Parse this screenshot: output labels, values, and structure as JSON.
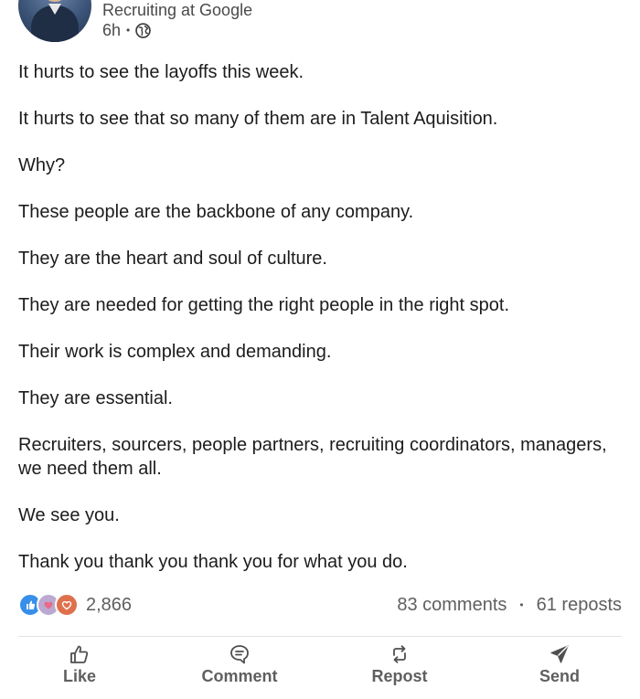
{
  "post": {
    "author_subtitle": "Recruiting at Google",
    "time_ago": "6h",
    "time_separator": "•",
    "visibility_icon": "globe-icon",
    "paragraphs": [
      "It hurts to see the layoffs this week.",
      "It hurts to see that so many of them are in Talent Aquisition.",
      "Why?",
      "These people are the backbone of any company.",
      "They are the heart and soul of culture.",
      "They are needed for getting the right people in the right spot.",
      "Their work is complex and demanding.",
      "They are essential.",
      "Recruiters, sourcers, people partners, recruiting coordinators, managers, we need them all.",
      "We see you.",
      "Thank you thank you thank you for what you do."
    ]
  },
  "social": {
    "reaction_icons": [
      "like-reaction-icon",
      "support-reaction-icon",
      "love-reaction-icon"
    ],
    "reactions_count": "2,866",
    "comments": "83 comments",
    "separator": "•",
    "reposts": "61 reposts"
  },
  "actions": {
    "like": "Like",
    "comment": "Comment",
    "repost": "Repost",
    "send": "Send"
  },
  "colors": {
    "text": "#1c1c1c",
    "muted": "#5f5f5f",
    "like_blue": "#378fe9",
    "support_purple": "#bba9d1",
    "love_orange": "#df704d"
  }
}
